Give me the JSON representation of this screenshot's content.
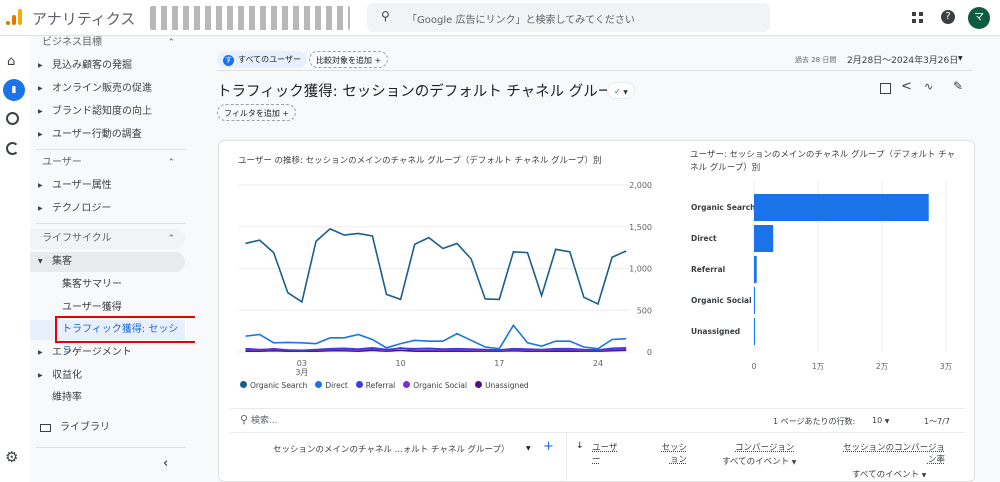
{
  "header": {
    "app_name": "アナリティクス",
    "search_placeholder": "「Google 広告にリンク」と検索してみてください",
    "avatar_letter": "マ"
  },
  "nav": {
    "sections": [
      {
        "label": "ビジネス目標",
        "items": [
          "見込み顧客の発掘",
          "オンライン販売の促進",
          "ブランド認知度の向上",
          "ユーザー行動の調査"
        ]
      },
      {
        "label": "ユーザー",
        "items": [
          "ユーザー属性",
          "テクノロジー"
        ]
      },
      {
        "label": "ライフサイクル"
      }
    ],
    "acquisition": "集客",
    "acq_children": [
      "集客サマリー",
      "ユーザー獲得",
      "トラフィック獲得: セッショ..."
    ],
    "after": [
      "エンゲージメント",
      "収益化",
      "維持率"
    ],
    "library": "ライブラリ"
  },
  "toolbar": {
    "segment": "すべてのユーザー",
    "segment_badge": "す",
    "add_compare": "比較対象を追加",
    "date_prefix": "過去 28 日間",
    "date_range": "2月28日〜2024年3月26日",
    "title": "トラフィック獲得: セッションのデフォルト チャネル グループ",
    "add_filter": "フィルタを追加"
  },
  "colors": {
    "organic": "#1a5f8a",
    "direct": "#1a73e8",
    "referral": "#3c3cd6",
    "social": "#7b2fd1",
    "unassigned": "#4a148c",
    "bar": "#1a73e8"
  },
  "chart_data": [
    {
      "type": "line",
      "title": "ユーザー の推移: セッションのメインのチャネル グループ（デフォルト チャネル グループ）別",
      "x_ticks": [
        {
          "i": 4,
          "label": "03",
          "sub": "3月"
        },
        {
          "i": 11,
          "label": "10"
        },
        {
          "i": 18,
          "label": "17"
        },
        {
          "i": 25,
          "label": "24"
        }
      ],
      "ylim": [
        0,
        2000
      ],
      "y_ticks": [
        {
          "v": 0,
          "label": "0"
        },
        {
          "v": 500,
          "label": "500"
        },
        {
          "v": 1000,
          "label": "1,000"
        },
        {
          "v": 1500,
          "label": "1,500"
        },
        {
          "v": 2000,
          "label": "2,000"
        }
      ],
      "series": [
        {
          "name": "Organic Search",
          "color": "#1a5f8a",
          "values": [
            1300,
            1340,
            1190,
            710,
            600,
            1325,
            1475,
            1400,
            1420,
            1390,
            690,
            630,
            1290,
            1370,
            1240,
            1300,
            1115,
            635,
            630,
            1200,
            1190,
            675,
            1230,
            1200,
            655,
            575,
            1135,
            1210
          ]
        },
        {
          "name": "Direct",
          "color": "#1a73e8",
          "values": [
            190,
            210,
            110,
            115,
            110,
            100,
            170,
            170,
            210,
            150,
            50,
            100,
            140,
            130,
            130,
            220,
            140,
            60,
            40,
            320,
            110,
            70,
            130,
            130,
            60,
            40,
            150,
            160
          ]
        },
        {
          "name": "Referral",
          "color": "#3c3cd6",
          "values": [
            40,
            30,
            35,
            25,
            20,
            30,
            40,
            45,
            35,
            50,
            30,
            45,
            40,
            45,
            35,
            40,
            35,
            30,
            25,
            40,
            35,
            30,
            40,
            40,
            30,
            25,
            45,
            50
          ]
        },
        {
          "name": "Organic Social",
          "color": "#7b2fd1",
          "values": [
            25,
            20,
            40,
            20,
            15,
            25,
            30,
            30,
            20,
            40,
            15,
            50,
            20,
            25,
            20,
            25,
            20,
            15,
            15,
            30,
            20,
            15,
            25,
            25,
            15,
            15,
            30,
            35
          ]
        },
        {
          "name": "Unassigned",
          "color": "#4a148c",
          "values": [
            10,
            10,
            15,
            10,
            10,
            10,
            15,
            15,
            10,
            20,
            10,
            20,
            10,
            10,
            10,
            10,
            10,
            10,
            10,
            15,
            10,
            10,
            10,
            10,
            10,
            10,
            15,
            20
          ]
        }
      ]
    },
    {
      "type": "bar",
      "title": "ユーザー: セッションのメインのチャネル グループ（デフォルト チャネル グループ）別",
      "categories": [
        "Organic Search",
        "Direct",
        "Referral",
        "Organic Social",
        "Unassigned"
      ],
      "values": [
        27300,
        3000,
        420,
        100,
        30
      ],
      "xlim": [
        0,
        30000
      ],
      "x_ticks": [
        {
          "v": 0,
          "label": "0"
        },
        {
          "v": 10000,
          "label": "1万"
        },
        {
          "v": 20000,
          "label": "2万"
        },
        {
          "v": 30000,
          "label": "3万"
        }
      ]
    }
  ],
  "table": {
    "search_placeholder": "検索...",
    "rows_per_page_label": "1 ページあたりの行数:",
    "rows_per_page": "10",
    "pagination": "1〜7/7",
    "dim_header": "セッションのメインのチャネル ...ォルト チャネル グループ）",
    "cols": [
      {
        "label": "ユーザー"
      },
      {
        "label": "セッション"
      },
      {
        "label": "コンバージョン",
        "sub": "すべてのイベント"
      },
      {
        "label": "セッションのコンバージョン率",
        "sub": "すべてのイベント"
      }
    ]
  }
}
